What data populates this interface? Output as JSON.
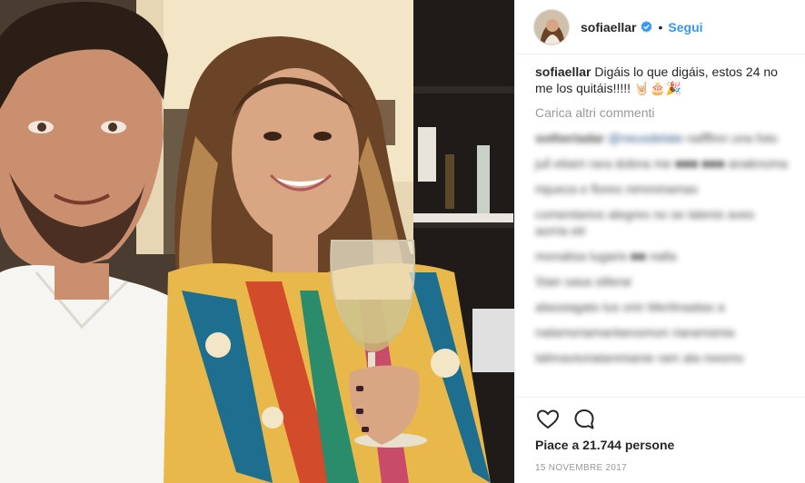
{
  "post": {
    "username": "sofiaellar",
    "follow_separator": "•",
    "follow_label": "Segui",
    "caption_user": "sofiaellar",
    "caption_text": " Digáis lo que digáis, estos 24 no me los quitáis!!!!! 🤘🏻🎂🎉",
    "load_more_label": "Carica altri commenti",
    "likes_text": "Piace a 21.744 persone",
    "date_text": "15 NOVEMBRE 2017"
  },
  "comments": [
    {
      "user": "sotheriadar",
      "mention": "@neusdelate",
      "text": " nafffinn una foto"
    },
    {
      "user": "",
      "mention": "",
      "text": "juli̇ etiam rara dobna me ■■■ ■■■ anaknoma"
    },
    {
      "user": "",
      "mention": "",
      "text": "riqueza e flores nimmiriamas"
    },
    {
      "user": "",
      "mention": "",
      "text": "comentarios alegres no se lalenis aves aorria etr"
    },
    {
      "user": "",
      "mention": "",
      "text": "monalisa lugaris ■■ nalla"
    },
    {
      "user": "",
      "mention": "",
      "text": "Stan sasa sillerai"
    },
    {
      "user": "",
      "mention": "",
      "text": "alassiagato lus orin Mertinaatas a"
    },
    {
      "user": "",
      "mention": "",
      "text": "nalamoriamantarosmon riaramsinia"
    },
    {
      "user": "",
      "mention": "",
      "text": "lalimavioriatanmianie ram ala nwsmo"
    }
  ],
  "icons": {
    "verified": "verified-badge-icon",
    "like": "heart-icon",
    "comment": "comment-bubble-icon"
  },
  "colors": {
    "link_blue": "#3897f0",
    "text": "#262626",
    "muted": "#999999",
    "border": "#efefef"
  }
}
